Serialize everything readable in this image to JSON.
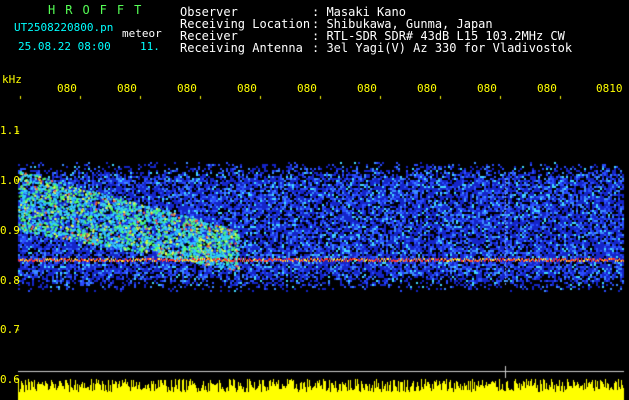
{
  "header": {
    "app": "HROFFT",
    "file": "UT2508220800.pn",
    "type": "meteor",
    "date": "25.08.22 08:00",
    "count": "11."
  },
  "info": [
    {
      "label": "Observer",
      "value": ": Masaki Kano"
    },
    {
      "label": "Receiving Location",
      "value": ": Shibukawa, Gunma, Japan"
    },
    {
      "label": "Receiver",
      "value": ": RTL-SDR SDR# 43dB L15 103.2MHz CW"
    },
    {
      "label": "Receiving Antenna",
      "value": ": 3el Yagi(V) Az 330 for Vladivostok"
    }
  ],
  "x_axis": {
    "ticks": [
      "080",
      "080",
      "080",
      "080",
      "080",
      "080",
      "080",
      "080",
      "080",
      "0810"
    ]
  },
  "y_axis": {
    "unit": "kHz",
    "ticks": [
      "1.1",
      "1.0",
      "0.9",
      "0.8",
      "0.7",
      "0.6"
    ]
  },
  "colors": {
    "text_cyan": "#00ffff",
    "text_white": "#ffffff",
    "text_yellow": "#ffff00",
    "noise_floor": "#1e2fff",
    "signal_line": "#ff3030"
  }
}
